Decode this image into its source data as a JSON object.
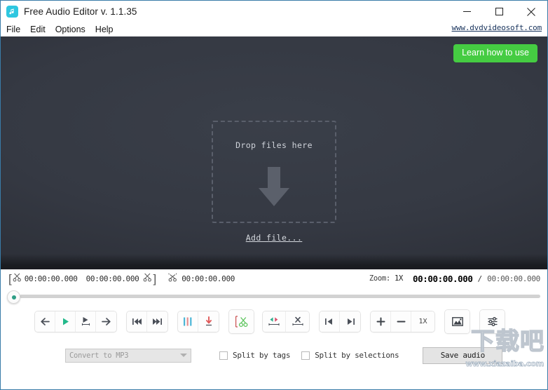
{
  "window": {
    "title": "Free Audio Editor v. 1.1.35",
    "app_icon": "music-note-icon",
    "minimize_label": "minimize-icon",
    "maximize_label": "maximize-icon",
    "close_label": "close-icon"
  },
  "menu": {
    "items": [
      {
        "label": "File"
      },
      {
        "label": "Edit"
      },
      {
        "label": "Options"
      },
      {
        "label": "Help"
      }
    ],
    "site_link": "www.dvdvideosoft.com"
  },
  "canvas": {
    "learn_button": "Learn how to use",
    "drop_text": "Drop files here",
    "add_file_link": "Add file...",
    "arrow_icon": "down-arrow-icon"
  },
  "timebar": {
    "selection_start": "00:00:00.000",
    "selection_end": "00:00:00.000",
    "marker_time": "00:00:00.000",
    "zoom_label": "Zoom:",
    "zoom_value": "1X",
    "current_time": "00:00:00.000",
    "separator": "/",
    "total_time": "00:00:00.000"
  },
  "toolbar": {
    "groups": [
      {
        "buttons": [
          {
            "name": "step-back-button",
            "icon": "arrow-left-icon"
          },
          {
            "name": "play-button",
            "icon": "play-icon"
          },
          {
            "name": "play-to-marker-button",
            "icon": "play-to-marker-icon"
          },
          {
            "name": "step-forward-button",
            "icon": "arrow-right-icon"
          }
        ]
      },
      {
        "buttons": [
          {
            "name": "go-to-start-button",
            "icon": "skip-previous-icon"
          },
          {
            "name": "go-to-end-button",
            "icon": "skip-next-icon"
          }
        ]
      },
      {
        "buttons": [
          {
            "name": "pause-markers-button",
            "icon": "colored-bars-icon"
          },
          {
            "name": "set-marker-button",
            "icon": "marker-down-icon"
          }
        ]
      },
      {
        "buttons": [
          {
            "name": "cut-selection-button",
            "icon": "scissors-icon"
          }
        ]
      },
      {
        "buttons": [
          {
            "name": "trim-selection-button",
            "icon": "trim-icon"
          },
          {
            "name": "delete-selection-button",
            "icon": "delete-segment-icon"
          }
        ]
      },
      {
        "buttons": [
          {
            "name": "selection-to-start-button",
            "icon": "align-left-icon"
          },
          {
            "name": "selection-to-end-button",
            "icon": "align-right-icon"
          }
        ]
      },
      {
        "buttons": [
          {
            "name": "zoom-in-button",
            "icon": "plus-icon",
            "label": "+"
          },
          {
            "name": "zoom-out-button",
            "icon": "minus-icon",
            "label": "−"
          },
          {
            "name": "zoom-reset-button",
            "icon": "zoom-1x-icon",
            "label": "1X"
          }
        ]
      },
      {
        "buttons": [
          {
            "name": "spectrogram-button",
            "icon": "spectrogram-icon"
          }
        ]
      },
      {
        "buttons": [
          {
            "name": "settings-button",
            "icon": "sliders-icon"
          }
        ]
      }
    ]
  },
  "bottombar": {
    "convert_value": "Convert to MP3",
    "convert_caret": "chevron-down-icon",
    "split_by_tags": "Split by tags",
    "split_by_selections": "Split by selections",
    "save_button": "Save audio"
  },
  "watermark": {
    "text_cn": "下载吧",
    "url": "www.xiazaiba.com"
  },
  "colors": {
    "accent_green": "#45cc42",
    "icon_teal": "#2ec7e0",
    "play_green": "#23b98b",
    "marker_red": "#e05a5a",
    "canvas_dark": "#353943",
    "border_blue": "#3a7ca8"
  }
}
